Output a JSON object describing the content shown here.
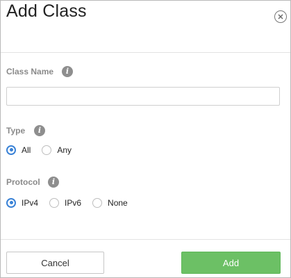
{
  "dialog": {
    "title": "Add Class",
    "close_icon": "close-circle-icon"
  },
  "class_name": {
    "label": "Class Name",
    "info_glyph": "i",
    "value": "",
    "placeholder": ""
  },
  "type": {
    "label": "Type",
    "info_glyph": "i",
    "options": [
      {
        "label": "All",
        "checked": true
      },
      {
        "label": "Any",
        "checked": false
      }
    ]
  },
  "protocol": {
    "label": "Protocol",
    "info_glyph": "i",
    "options": [
      {
        "label": "IPv4",
        "checked": true
      },
      {
        "label": "IPv6",
        "checked": false
      },
      {
        "label": "None",
        "checked": false
      }
    ]
  },
  "footer": {
    "cancel_label": "Cancel",
    "add_label": "Add"
  },
  "colors": {
    "accent_radio": "#3a82d6",
    "add_button": "#6cc065",
    "info_icon": "#8e8e8e"
  }
}
